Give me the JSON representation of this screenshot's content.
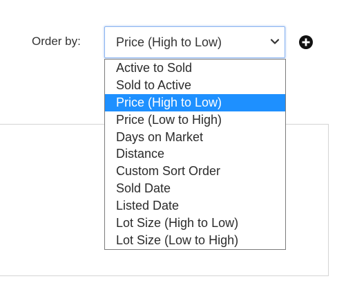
{
  "filter": {
    "order_label": "Order by:",
    "selected_value": "Price (High to Low)",
    "add_icon": "plus-circle-icon",
    "chevron_icon": "chevron-down-icon"
  },
  "dropdown": {
    "selected_index": 2,
    "highlight_color": "#1e90ff",
    "options": [
      "Active to Sold",
      "Sold to Active",
      "Price (High to Low)",
      "Price (Low to High)",
      "Days on Market",
      "Distance",
      "Custom Sort Order",
      "Sold Date",
      "Listed Date",
      "Lot Size (High to Low)",
      "Lot Size (Low to High)"
    ]
  }
}
